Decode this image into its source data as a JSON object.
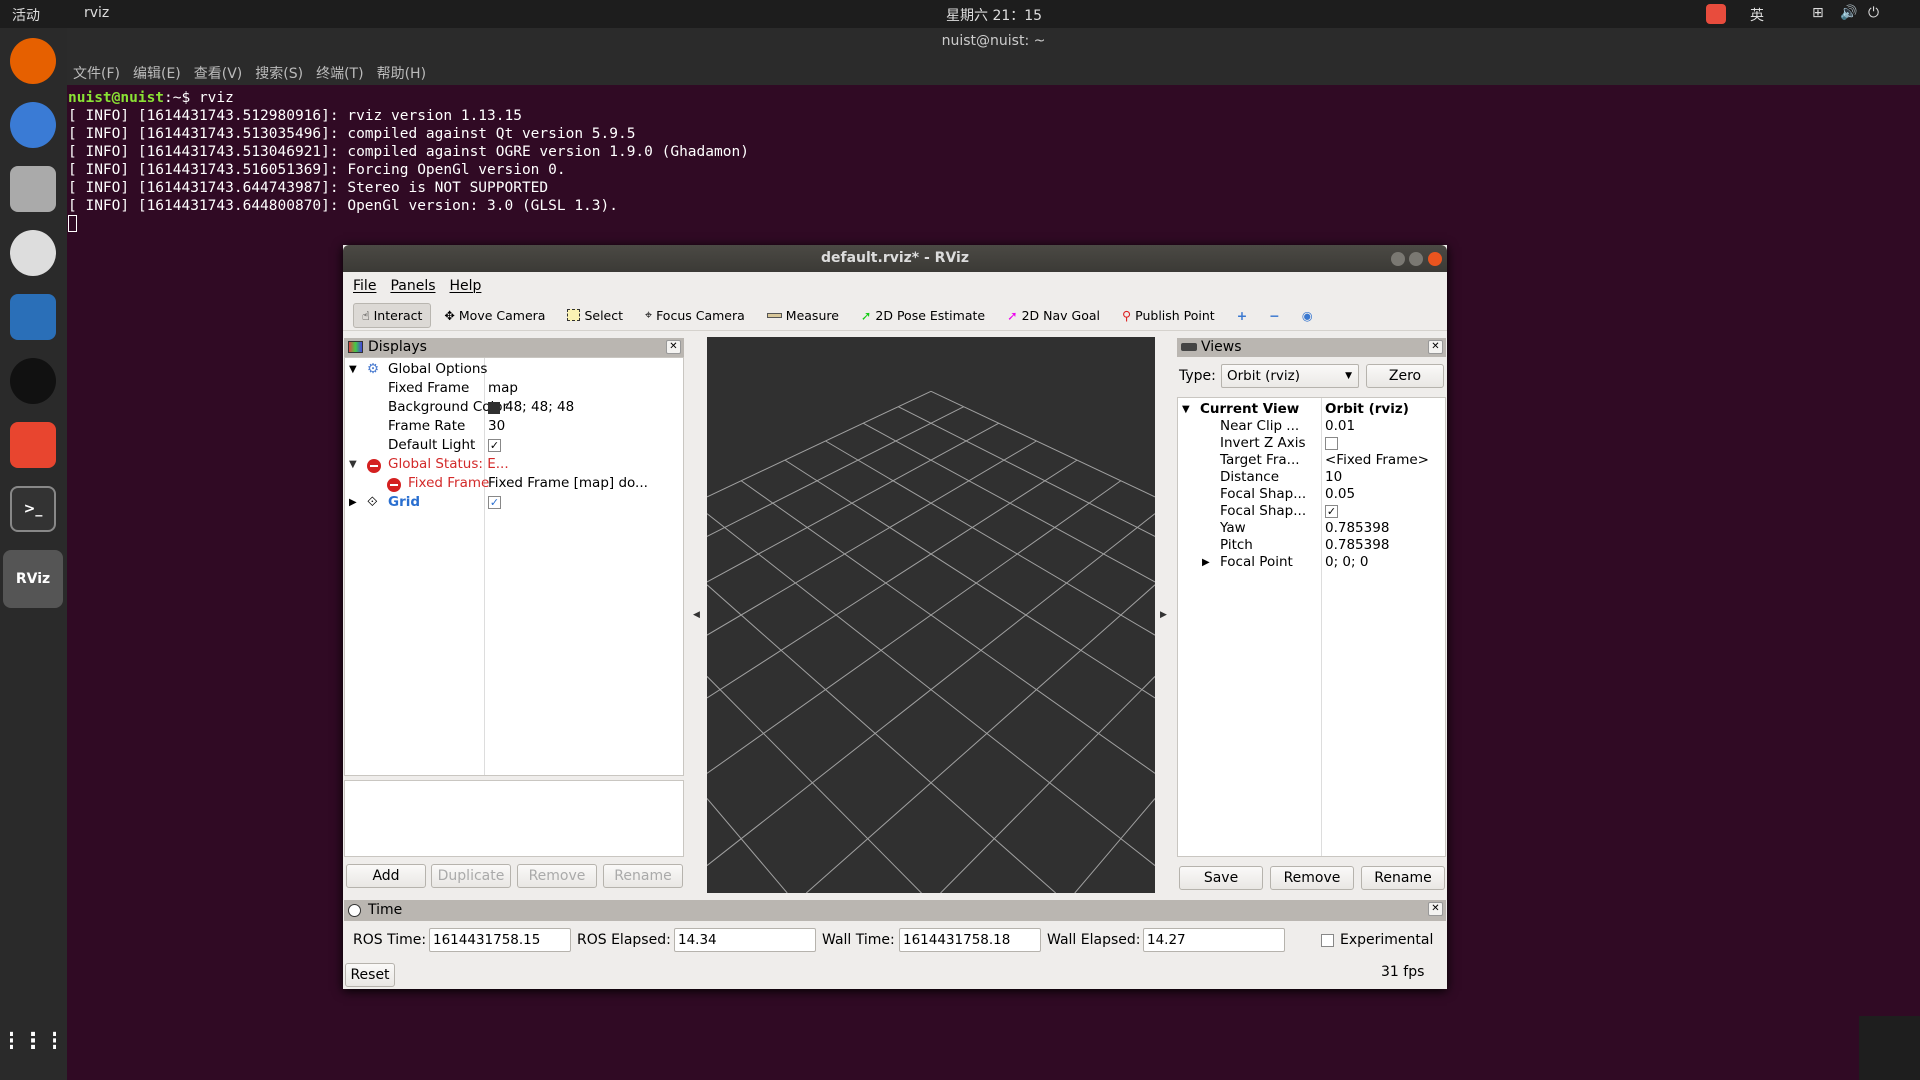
{
  "topbar": {
    "activities": "活动",
    "app": "rviz",
    "clock": "星期六 21：15",
    "input_method": "英"
  },
  "dock": {
    "items": [
      "firefox",
      "thunderbird",
      "files",
      "rhythmbox",
      "libreoffice-writer",
      "qq",
      "ksnip",
      "terminal",
      "rviz",
      "show-applications"
    ],
    "rviz_label": "RViz"
  },
  "terminal": {
    "title": "nuist@nuist: ~",
    "menu": [
      "文件(F)",
      "编辑(E)",
      "查看(V)",
      "搜索(S)",
      "终端(T)",
      "帮助(H)"
    ],
    "prompt_user": "nuist@nuist",
    "prompt_rest": ":~$ rviz",
    "lines": [
      "[ INFO] [1614431743.512980916]: rviz version 1.13.15",
      "[ INFO] [1614431743.513035496]: compiled against Qt version 5.9.5",
      "[ INFO] [1614431743.513046921]: compiled against OGRE version 1.9.0 (Ghadamon)",
      "[ INFO] [1614431743.516051369]: Forcing OpenGl version 0.",
      "[ INFO] [1614431743.644743987]: Stereo is NOT SUPPORTED",
      "[ INFO] [1614431743.644800870]: OpenGl version: 3.0 (GLSL 1.3)."
    ]
  },
  "rviz": {
    "title": "default.rviz* - RViz",
    "menu": [
      "File",
      "Panels",
      "Help"
    ],
    "tools": [
      {
        "label": "Interact",
        "icon": "hand-icon"
      },
      {
        "label": "Move Camera",
        "icon": "move-icon"
      },
      {
        "label": "Select",
        "icon": "select-icon"
      },
      {
        "label": "Focus Camera",
        "icon": "focus-icon"
      },
      {
        "label": "Measure",
        "icon": "ruler-icon"
      },
      {
        "label": "2D Pose Estimate",
        "icon": "green-arrow-icon"
      },
      {
        "label": "2D Nav Goal",
        "icon": "magenta-arrow-icon"
      },
      {
        "label": "Publish Point",
        "icon": "pin-icon"
      }
    ],
    "displays": {
      "title": "Displays",
      "rows": [
        {
          "k": "Global Options",
          "v": ""
        },
        {
          "k": "Fixed Frame",
          "v": "map"
        },
        {
          "k": "Background Color",
          "v": "48; 48; 48"
        },
        {
          "k": "Frame Rate",
          "v": "30"
        },
        {
          "k": "Default Light",
          "v": "✓"
        },
        {
          "k": "Global Status: E...",
          "v": ""
        },
        {
          "k": "Fixed Frame",
          "v": "Fixed Frame [map] do..."
        },
        {
          "k": "Grid",
          "v": "✓"
        }
      ],
      "buttons": [
        "Add",
        "Duplicate",
        "Remove",
        "Rename"
      ]
    },
    "views": {
      "title": "Views",
      "type_label": "Type:",
      "type_value": "Orbit (rviz)",
      "zero": "Zero",
      "rows": [
        {
          "k": "Current View",
          "v": "Orbit (rviz)"
        },
        {
          "k": "Near Clip ...",
          "v": "0.01"
        },
        {
          "k": "Invert Z Axis",
          "v": ""
        },
        {
          "k": "Target Fra...",
          "v": "<Fixed Frame>"
        },
        {
          "k": "Distance",
          "v": "10"
        },
        {
          "k": "Focal Shap...",
          "v": "0.05"
        },
        {
          "k": "Focal Shap...",
          "v": "✓"
        },
        {
          "k": "Yaw",
          "v": "0.785398"
        },
        {
          "k": "Pitch",
          "v": "0.785398"
        },
        {
          "k": "Focal Point",
          "v": "0; 0; 0"
        }
      ],
      "buttons": [
        "Save",
        "Remove",
        "Rename"
      ]
    },
    "time": {
      "title": "Time",
      "ros_time_label": "ROS Time:",
      "ros_time": "1614431758.15",
      "ros_elapsed_label": "ROS Elapsed:",
      "ros_elapsed": "14.34",
      "wall_time_label": "Wall Time:",
      "wall_time": "1614431758.18",
      "wall_elapsed_label": "Wall Elapsed:",
      "wall_elapsed": "14.27",
      "experimental": "Experimental",
      "reset": "Reset",
      "fps": "31 fps"
    },
    "colors": {
      "viewport_bg": "#303030",
      "grid": "#a0a0a0",
      "error": "#d32a2a"
    }
  }
}
